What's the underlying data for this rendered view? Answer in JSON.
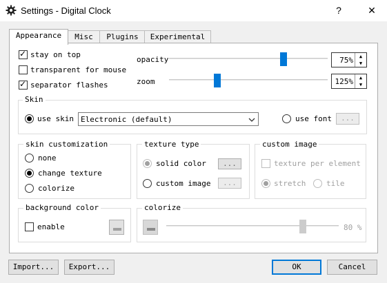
{
  "window": {
    "title": "Settings - Digital Clock",
    "help_glyph": "?",
    "close_glyph": "✕"
  },
  "tabs": [
    {
      "label": "Appearance"
    },
    {
      "label": "Misc"
    },
    {
      "label": "Plugins"
    },
    {
      "label": "Experimental"
    }
  ],
  "general": {
    "stay_on_top": {
      "label": "stay on top",
      "checked": true
    },
    "transparent_for_mouse": {
      "label": "transparent for mouse",
      "checked": false
    },
    "separator_flashes": {
      "label": "separator flashes",
      "checked": true
    },
    "opacity": {
      "label": "opacity",
      "value": "75%",
      "level": 0.75
    },
    "zoom": {
      "label": "zoom",
      "value": "125%"
    }
  },
  "skin": {
    "title": "Skin",
    "use_skin_label": "use skin",
    "selected_skin": "Electronic (default)",
    "use_font_label": "use font",
    "font_button": "..."
  },
  "skin_customization": {
    "title": "skin customization",
    "options": [
      "none",
      "change texture",
      "colorize"
    ],
    "selected": "change texture"
  },
  "texture_type": {
    "title": "texture type",
    "solid_color": "solid color",
    "custom_image": "custom image",
    "button": "..."
  },
  "custom_image": {
    "title": "custom image",
    "texture_per_element": "texture per element",
    "stretch": "stretch",
    "tile": "tile"
  },
  "background_color": {
    "title": "background color",
    "enable_label": "enable"
  },
  "colorize": {
    "title": "colorize",
    "value": "80 %",
    "level": 0.8
  },
  "footer": {
    "import": "Import...",
    "export": "Export...",
    "ok": "OK",
    "cancel": "Cancel"
  },
  "icons": {
    "app": "gear-icon",
    "dropdown": "chevron-down-icon",
    "spin_up": "spin-up-icon",
    "spin_down": "spin-down-icon"
  },
  "colors": {
    "accent": "#0078d7",
    "window_bg": "#f0f0f0",
    "panel_bg": "#ffffff"
  }
}
